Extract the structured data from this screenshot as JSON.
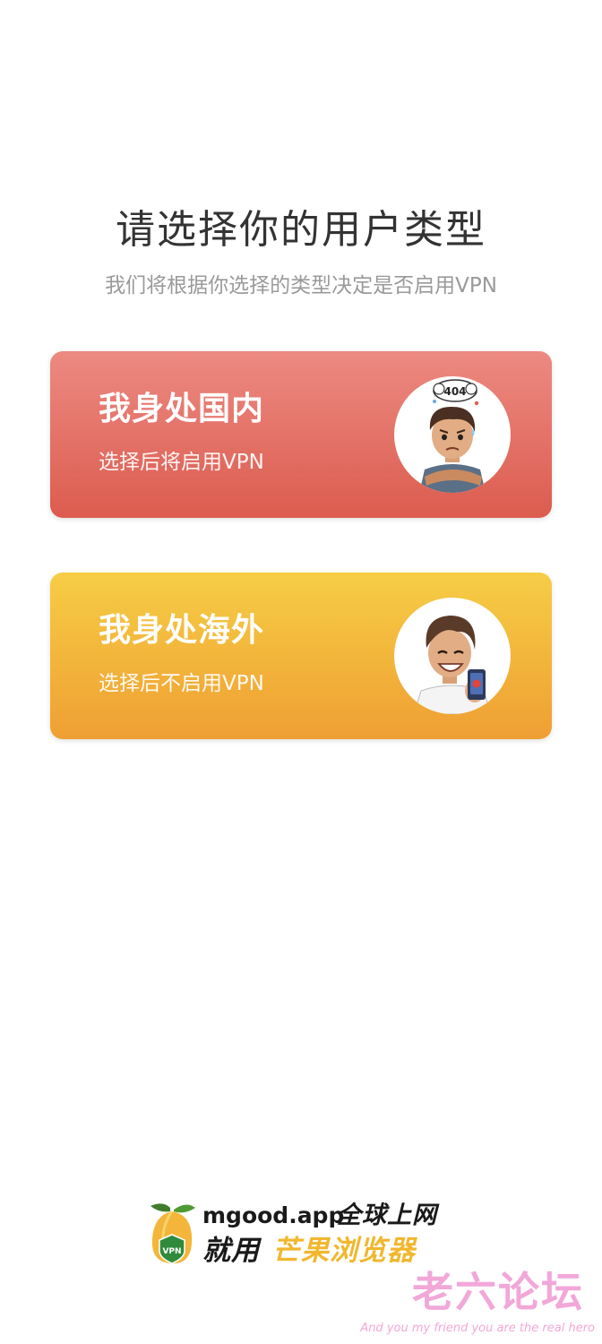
{
  "header": {
    "title": "请选择你的用户类型",
    "subtitle": "我们将根据你选择的类型决定是否启用VPN"
  },
  "options": [
    {
      "title": "我身处国内",
      "description": "选择后将启用VPN",
      "avatar_badge": "404",
      "avatar_icon": "confused-man-404-avatar",
      "colors": {
        "top": "#ec8a82",
        "bottom": "#dc5c4f"
      }
    },
    {
      "title": "我身处海外",
      "description": "选择后不启用VPN",
      "avatar_icon": "smiling-man-phone-avatar",
      "colors": {
        "top": "#f6cd45",
        "bottom": "#ef9f33"
      }
    }
  ],
  "brand": {
    "domain": "mgood.app",
    "slogan_line1": "全球上网",
    "slogan_use": "就用",
    "slogan_name": "芒果浏览器",
    "logo_badge": "VPN",
    "logo_icon": "mango-logo-icon",
    "accent_color": "#f1b72d"
  },
  "watermark": {
    "title": "老六论坛",
    "motto": "And you my friend you are the real hero",
    "color": "#f2a7d9"
  }
}
